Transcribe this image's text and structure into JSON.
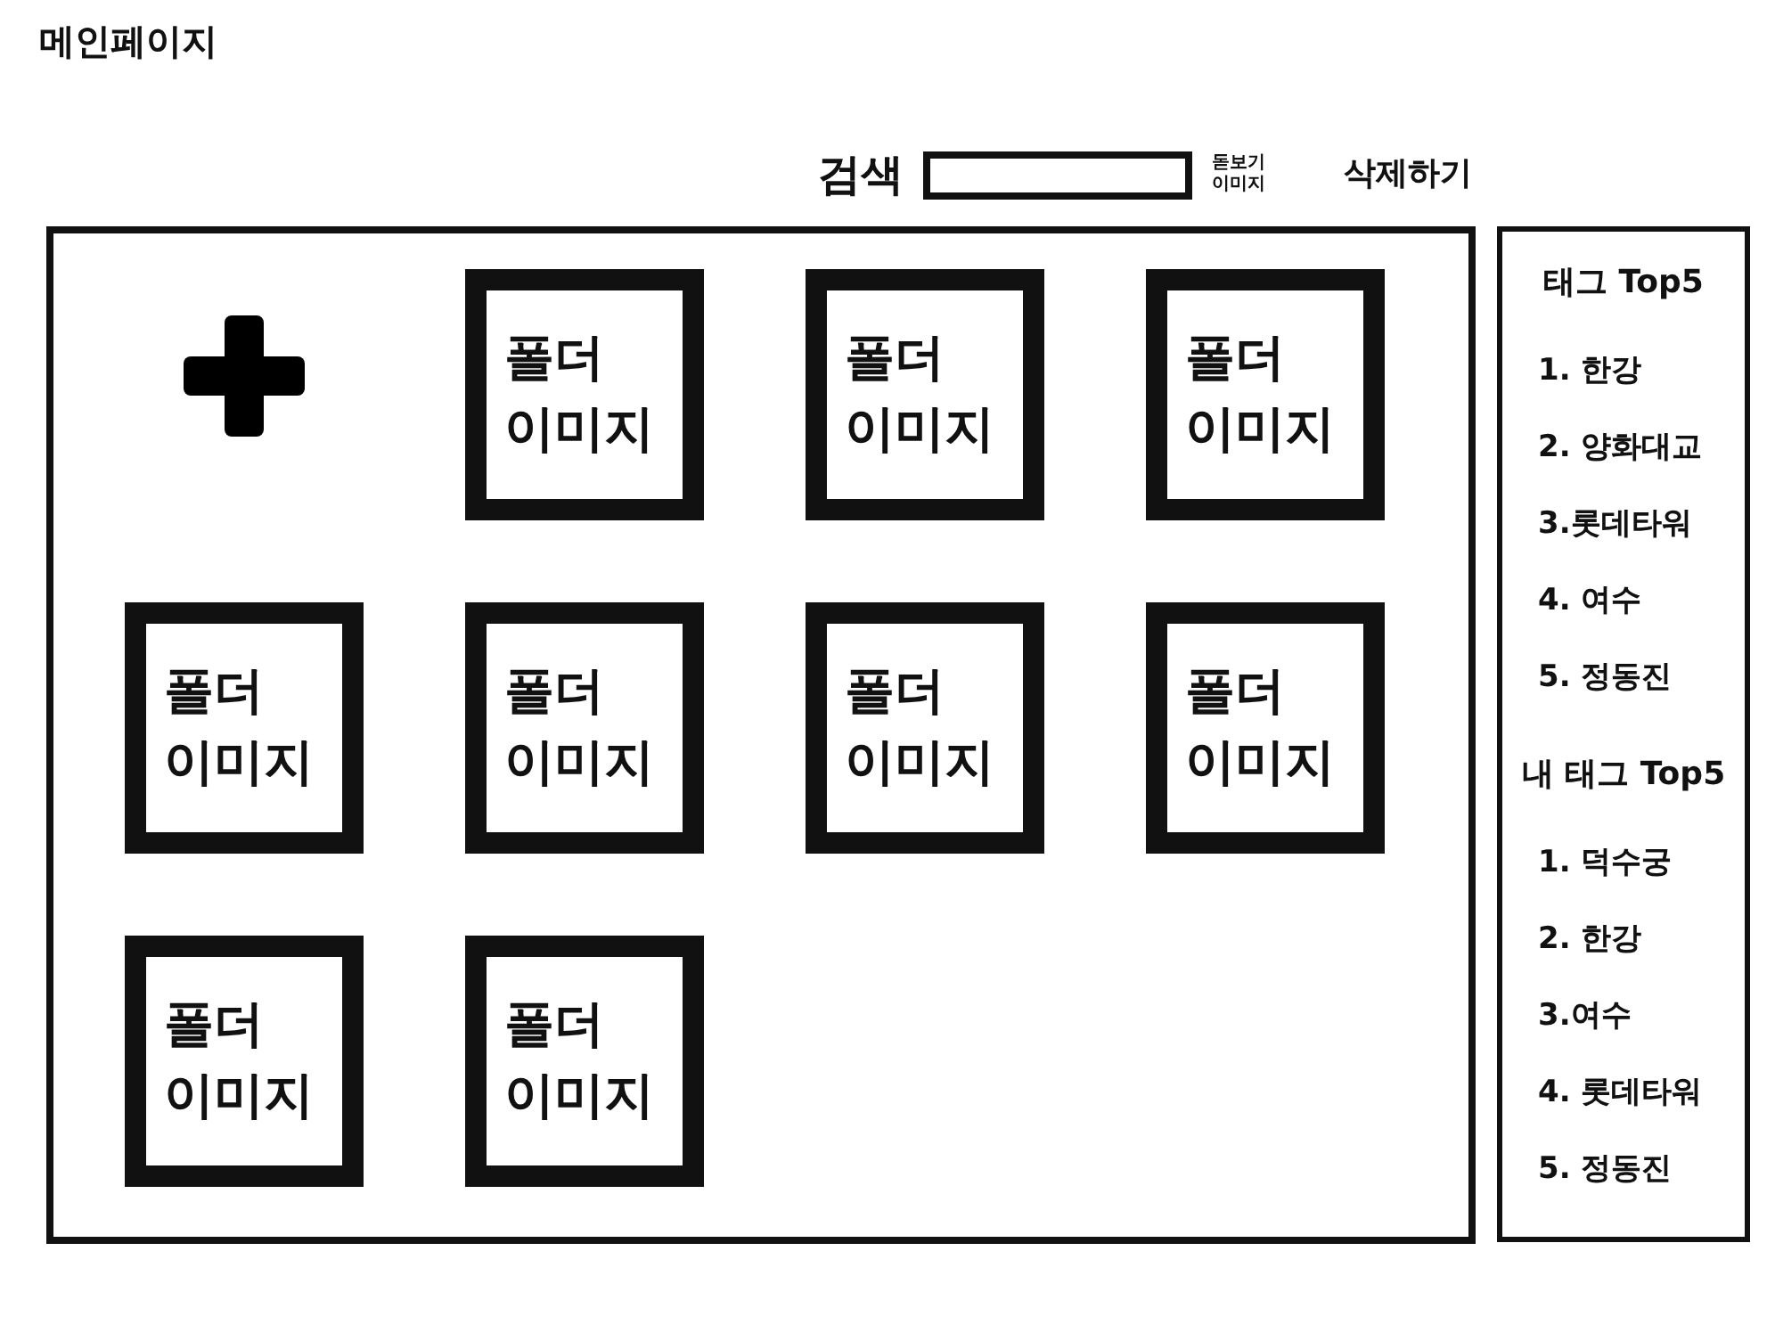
{
  "page": {
    "title": "메인페이지"
  },
  "toolbar": {
    "search_label": "검색",
    "icon_label": "돋보기 이미지",
    "delete_button": "삭제하기"
  },
  "folders": [
    {
      "label": "폴더 이미지"
    },
    {
      "label": "폴더 이미지"
    },
    {
      "label": "폴더 이미지"
    },
    {
      "label": "폴더 이미지"
    },
    {
      "label": "폴더 이미지"
    },
    {
      "label": "폴더 이미지"
    },
    {
      "label": "폴더 이미지"
    },
    {
      "label": "폴더 이미지"
    },
    {
      "label": "폴더 이미지"
    }
  ],
  "sidebar": {
    "sections": [
      {
        "title": "태그 Top5",
        "items": [
          "1. 한강",
          "2. 양화대교",
          "3.롯데타워",
          "4. 여수",
          "5. 정동진"
        ]
      },
      {
        "title": "내 태그 Top5",
        "items": [
          "1. 덕수궁",
          "2. 한강",
          "3.여수",
          "4. 롯데타워",
          "5. 정동진"
        ]
      }
    ]
  }
}
